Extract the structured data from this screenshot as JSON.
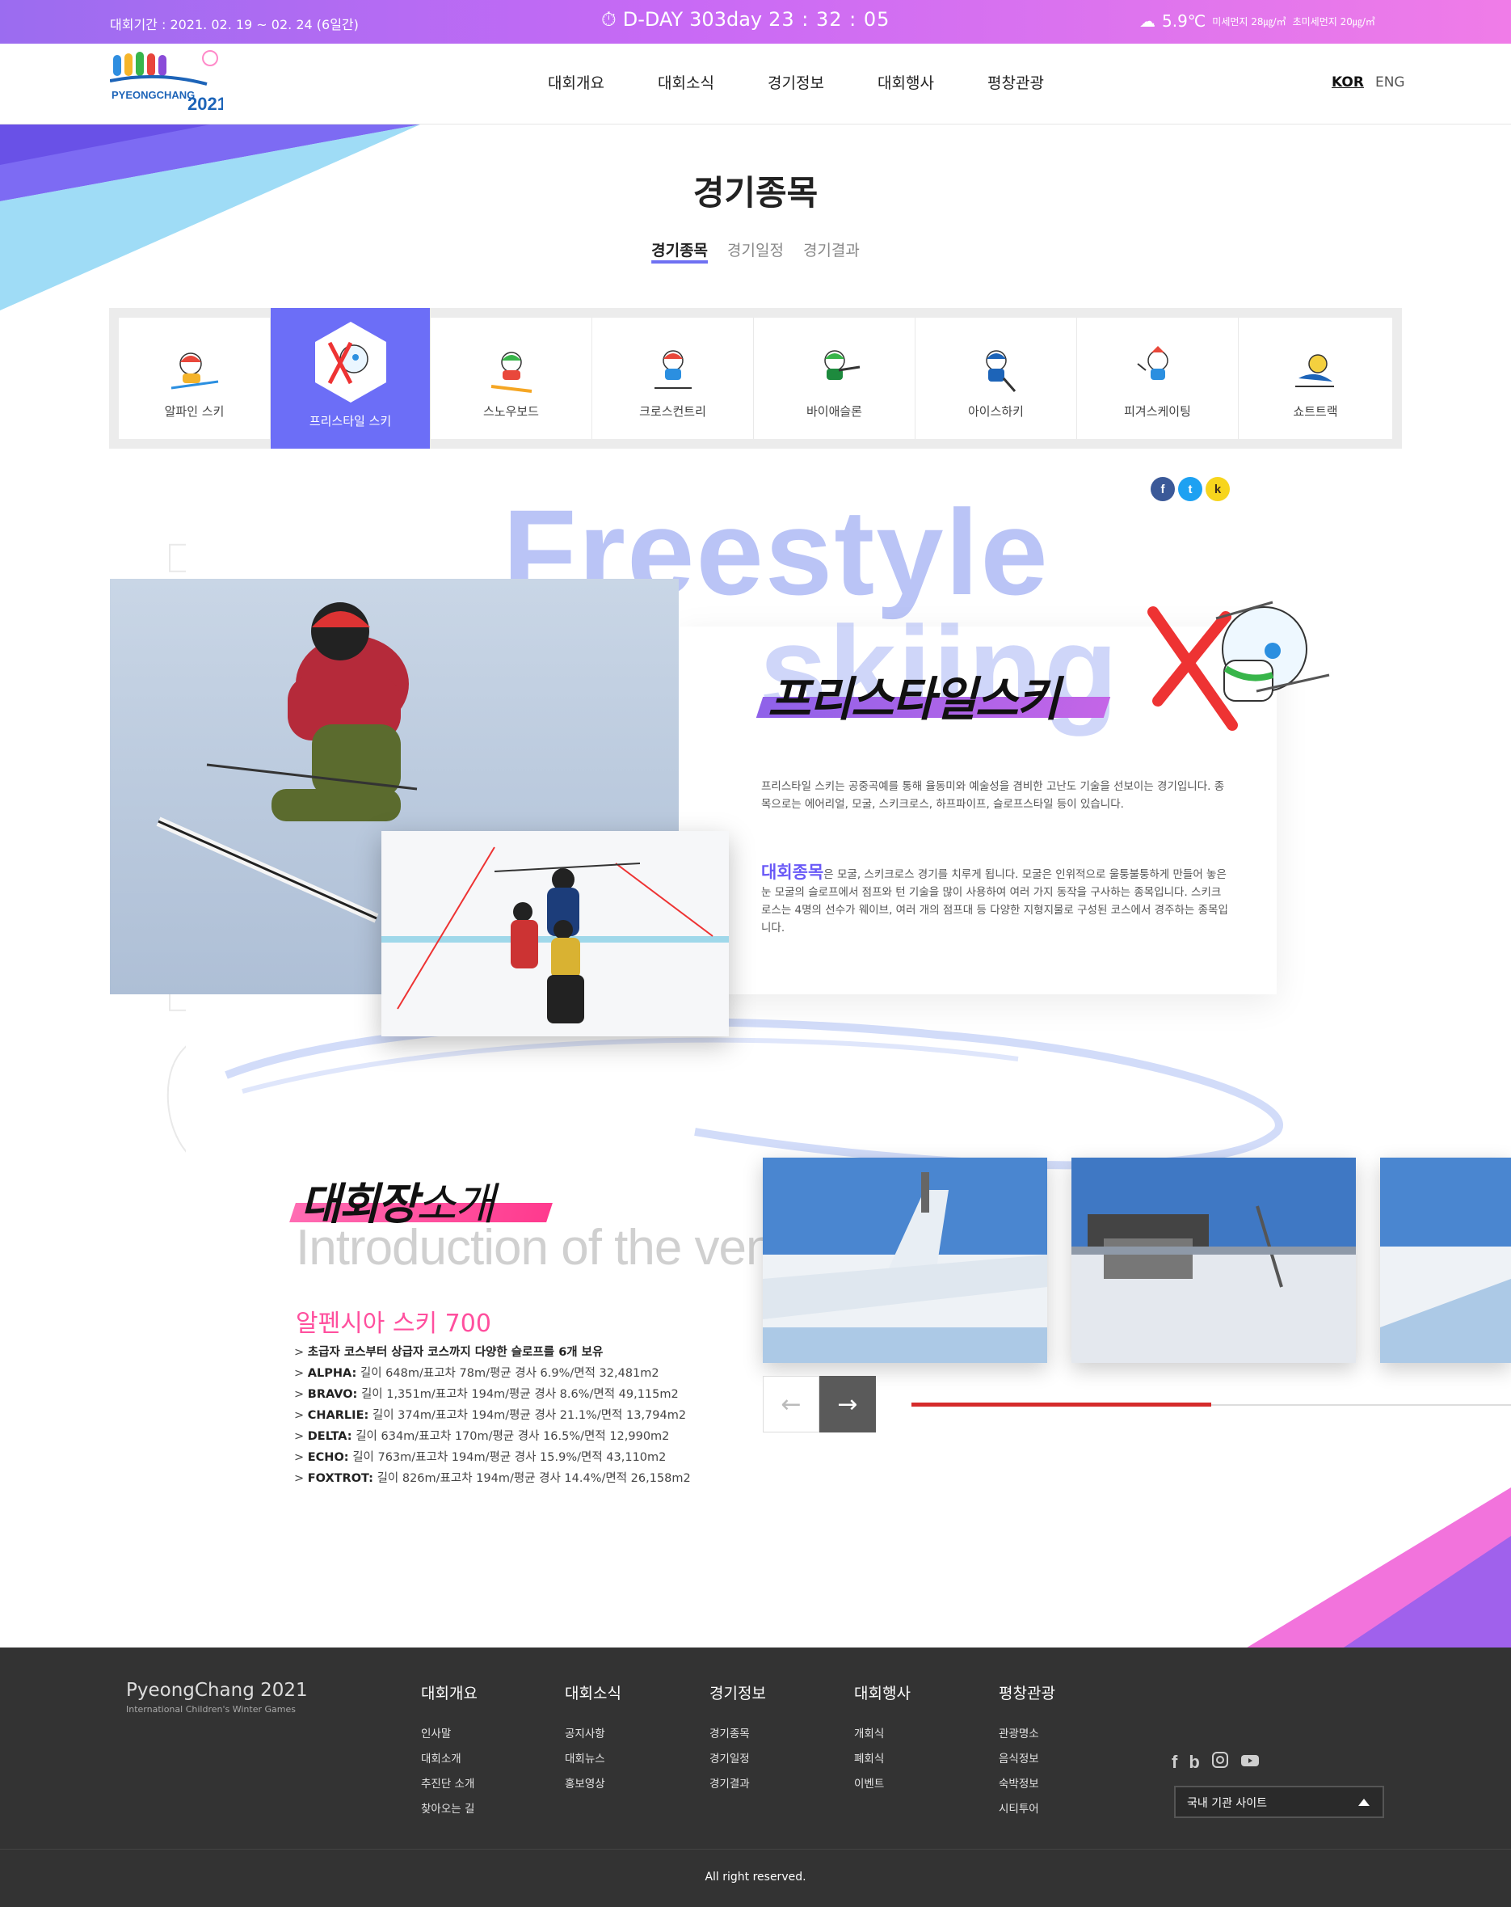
{
  "topbar": {
    "period": "대회기간 : 2021. 02. 19 ~ 02. 24 (6일간)",
    "dday_label": "D-DAY",
    "dday_days": "303day",
    "dday_time": "23 : 32 : 05",
    "temperature": "5.9℃",
    "fine_dust": "미세먼지 28㎍/㎥",
    "ultra_fine_dust": "초미세먼지 20㎍/㎥"
  },
  "header": {
    "logo_text": "PYEONGCHANG 2021",
    "nav": [
      "대회개요",
      "대회소식",
      "경기정보",
      "대회행사",
      "평창관광"
    ],
    "lang_active": "KOR",
    "lang_other": "ENG"
  },
  "page": {
    "title": "경기종목",
    "subtabs": [
      "경기종목",
      "경기일정",
      "경기결과"
    ],
    "active_subtab": "경기종목"
  },
  "events": {
    "tabs": [
      "알파인 스키",
      "프리스타일 스키",
      "스노우보드",
      "크로스컨트리",
      "바이애슬론",
      "아이스하키",
      "피겨스케이팅",
      "쇼트트랙"
    ],
    "active": "프리스타일 스키"
  },
  "share": {
    "facebook": "f",
    "twitter": "t",
    "kakao": "k"
  },
  "hero": {
    "bg_text_line1": "Freestyle",
    "bg_text_line2": "skiing",
    "kor_title": "프리스타일스키",
    "desc1": "프리스타일 스키는 공중곡예를 통해 율동미와 예술성을 겸비한 고난도 기술을 선보이는 경기입니다. 종목으로는 에어리얼, 모굴, 스키크로스, 하프파이프, 슬로프스타일 등이 있습니다.",
    "desc2_highlight": "대회종목",
    "desc2": "은 모굴, 스키크로스 경기를 치루게 됩니다. 모굴은 인위적으로 울퉁불퉁하게 만들어 놓은 눈 모굴의 슬로프에서 점프와 턴 기술을 많이 사용하여 여러 가지 동작을 구사하는 종목입니다. 스키크로스는 4명의 선수가 웨이브, 여러 개의 점프대 등 다양한 지형지물로 구성된 코스에서 경주하는 종목입니다."
  },
  "venue": {
    "title_bold": "대회장",
    "title_light": "소개",
    "subtitle": "Introduction of the venue",
    "name": "알펜시아 스키 700",
    "intro": "초급자 코스부터 상급자 코스까지 다양한 슬로프를 6개 보유",
    "courses": [
      {
        "name": "ALPHA:",
        "spec": "길이 648m/표고차 78m/평균 경사 6.9%/면적 32,481m2"
      },
      {
        "name": "BRAVO:",
        "spec": "길이 1,351m/표고차 194m/평균 경사 8.6%/면적 49,115m2"
      },
      {
        "name": "CHARLIE:",
        "spec": "길이 374m/표고차 194m/평균 경사 21.1%/면적 13,794m2"
      },
      {
        "name": "DELTA:",
        "spec": "길이 634m/표고차 170m/평균 경사 16.5%/면적 12,990m2"
      },
      {
        "name": "ECHO:",
        "spec": "길이 763m/표고차 194m/평균 경사 15.9%/면적 43,110m2"
      },
      {
        "name": "FOXTROT:",
        "spec": "길이 826m/표고차 194m/평균 경사 14.4%/면적 26,158m2"
      }
    ],
    "slider_prev": "←",
    "slider_next": "→",
    "slider_progress": 0.5
  },
  "footer": {
    "brand": "PyeongChang 2021",
    "brand_sub": "International Children's Winter Games",
    "columns": [
      {
        "title": "대회개요",
        "links": [
          "인사말",
          "대회소개",
          "추진단 소개",
          "찾아오는 길"
        ]
      },
      {
        "title": "대회소식",
        "links": [
          "공지사항",
          "대회뉴스",
          "홍보영상"
        ]
      },
      {
        "title": "경기정보",
        "links": [
          "경기종목",
          "경기일정",
          "경기결과"
        ]
      },
      {
        "title": "대회행사",
        "links": [
          "개회식",
          "폐회식",
          "이벤트"
        ]
      },
      {
        "title": "평창관광",
        "links": [
          "관광명소",
          "음식정보",
          "숙박정보",
          "시티투어"
        ]
      }
    ],
    "social": [
      "facebook-icon",
      "blog-icon",
      "instagram-icon",
      "youtube-icon"
    ],
    "site_select": "국내 기관 사이트",
    "copyright": "All right reserved."
  },
  "colors": {
    "accent_purple": "#6c6ef7",
    "accent_pink": "#ff4f9e",
    "slider_red": "#d52b2b",
    "footer_bg": "#333333"
  }
}
